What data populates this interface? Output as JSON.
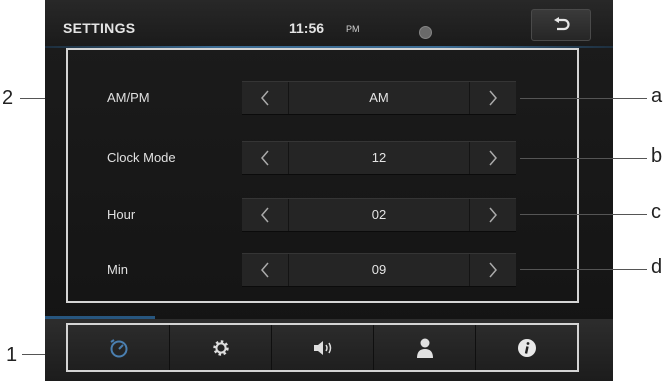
{
  "header": {
    "title": "SETTINGS",
    "time": "11:56",
    "ampm": "PM"
  },
  "settings": [
    {
      "label": "AM/PM",
      "value": "AM"
    },
    {
      "label": "Clock Mode",
      "value": "12"
    },
    {
      "label": "Hour",
      "value": "02"
    },
    {
      "label": "Min",
      "value": "09"
    }
  ],
  "tabs": [
    {
      "icon": "clock-icon",
      "active": true
    },
    {
      "icon": "gear-icon",
      "active": false
    },
    {
      "icon": "speaker-icon",
      "active": false
    },
    {
      "icon": "person-icon",
      "active": false
    },
    {
      "icon": "info-icon",
      "active": false
    }
  ],
  "callouts": {
    "bottom_bar": "1",
    "settings_area": "2",
    "a": "a",
    "b": "b",
    "c": "c",
    "d": "d"
  },
  "colors": {
    "accent": "#3c6c94",
    "active_tab": "#4a7fb0",
    "background": "#171717"
  }
}
